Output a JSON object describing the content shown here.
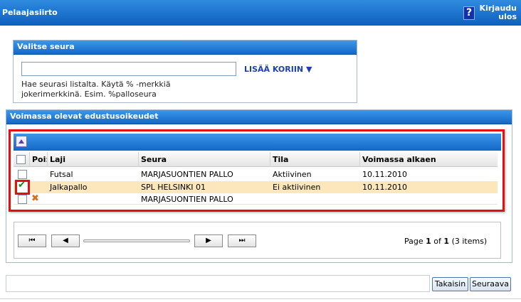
{
  "header": {
    "title": "Pelaajasiirto",
    "help_glyph": "?",
    "logout_line1": "Kirjaudu",
    "logout_line2": "ulos"
  },
  "club_panel": {
    "title": "Valitse seura",
    "input_value": "",
    "add_link": "LISÄÄ KORIIN ▼",
    "hint": "Hae seurasi listalta. Käytä % -merkkiä jokerimerkkinä. Esim. %palloseura"
  },
  "rights_panel": {
    "title": "Voimassa olevat edustusoikeudet",
    "columns": {
      "remove": "Poi:",
      "sport": "Laji",
      "club": "Seura",
      "status": "Tila",
      "valid_from": "Voimassa alkaen"
    },
    "rows": [
      {
        "sport": "Futsal",
        "club": "MARJASUONTIEN PALLO",
        "status": "Aktiivinen",
        "valid_from": "10.11.2010",
        "checked": false
      },
      {
        "sport": "Jalkapallo",
        "club": "SPL HELSINKI 01",
        "status": "Ei aktiivinen",
        "valid_from": "10.11.2010",
        "checked": true
      },
      {
        "sport": "",
        "club": "MARJASUONTIEN PALLO",
        "status": "",
        "valid_from": "",
        "checked": false
      }
    ],
    "pager": {
      "first": "⏮",
      "prev": "◀",
      "next": "▶",
      "last": "⏭",
      "label_page": "Page",
      "current": "1",
      "label_of": "of",
      "total": "1",
      "items": "(3 items)"
    }
  },
  "footer": {
    "back": "Takaisin",
    "next": "Seuraava"
  },
  "icons": {
    "tick": "✔",
    "delete": "✖"
  },
  "colors": {
    "header_blue": "#1268c9",
    "selected_row": "#fbe7bb",
    "highlight_red": "#e21010",
    "link_blue": "#1d3fb5"
  }
}
